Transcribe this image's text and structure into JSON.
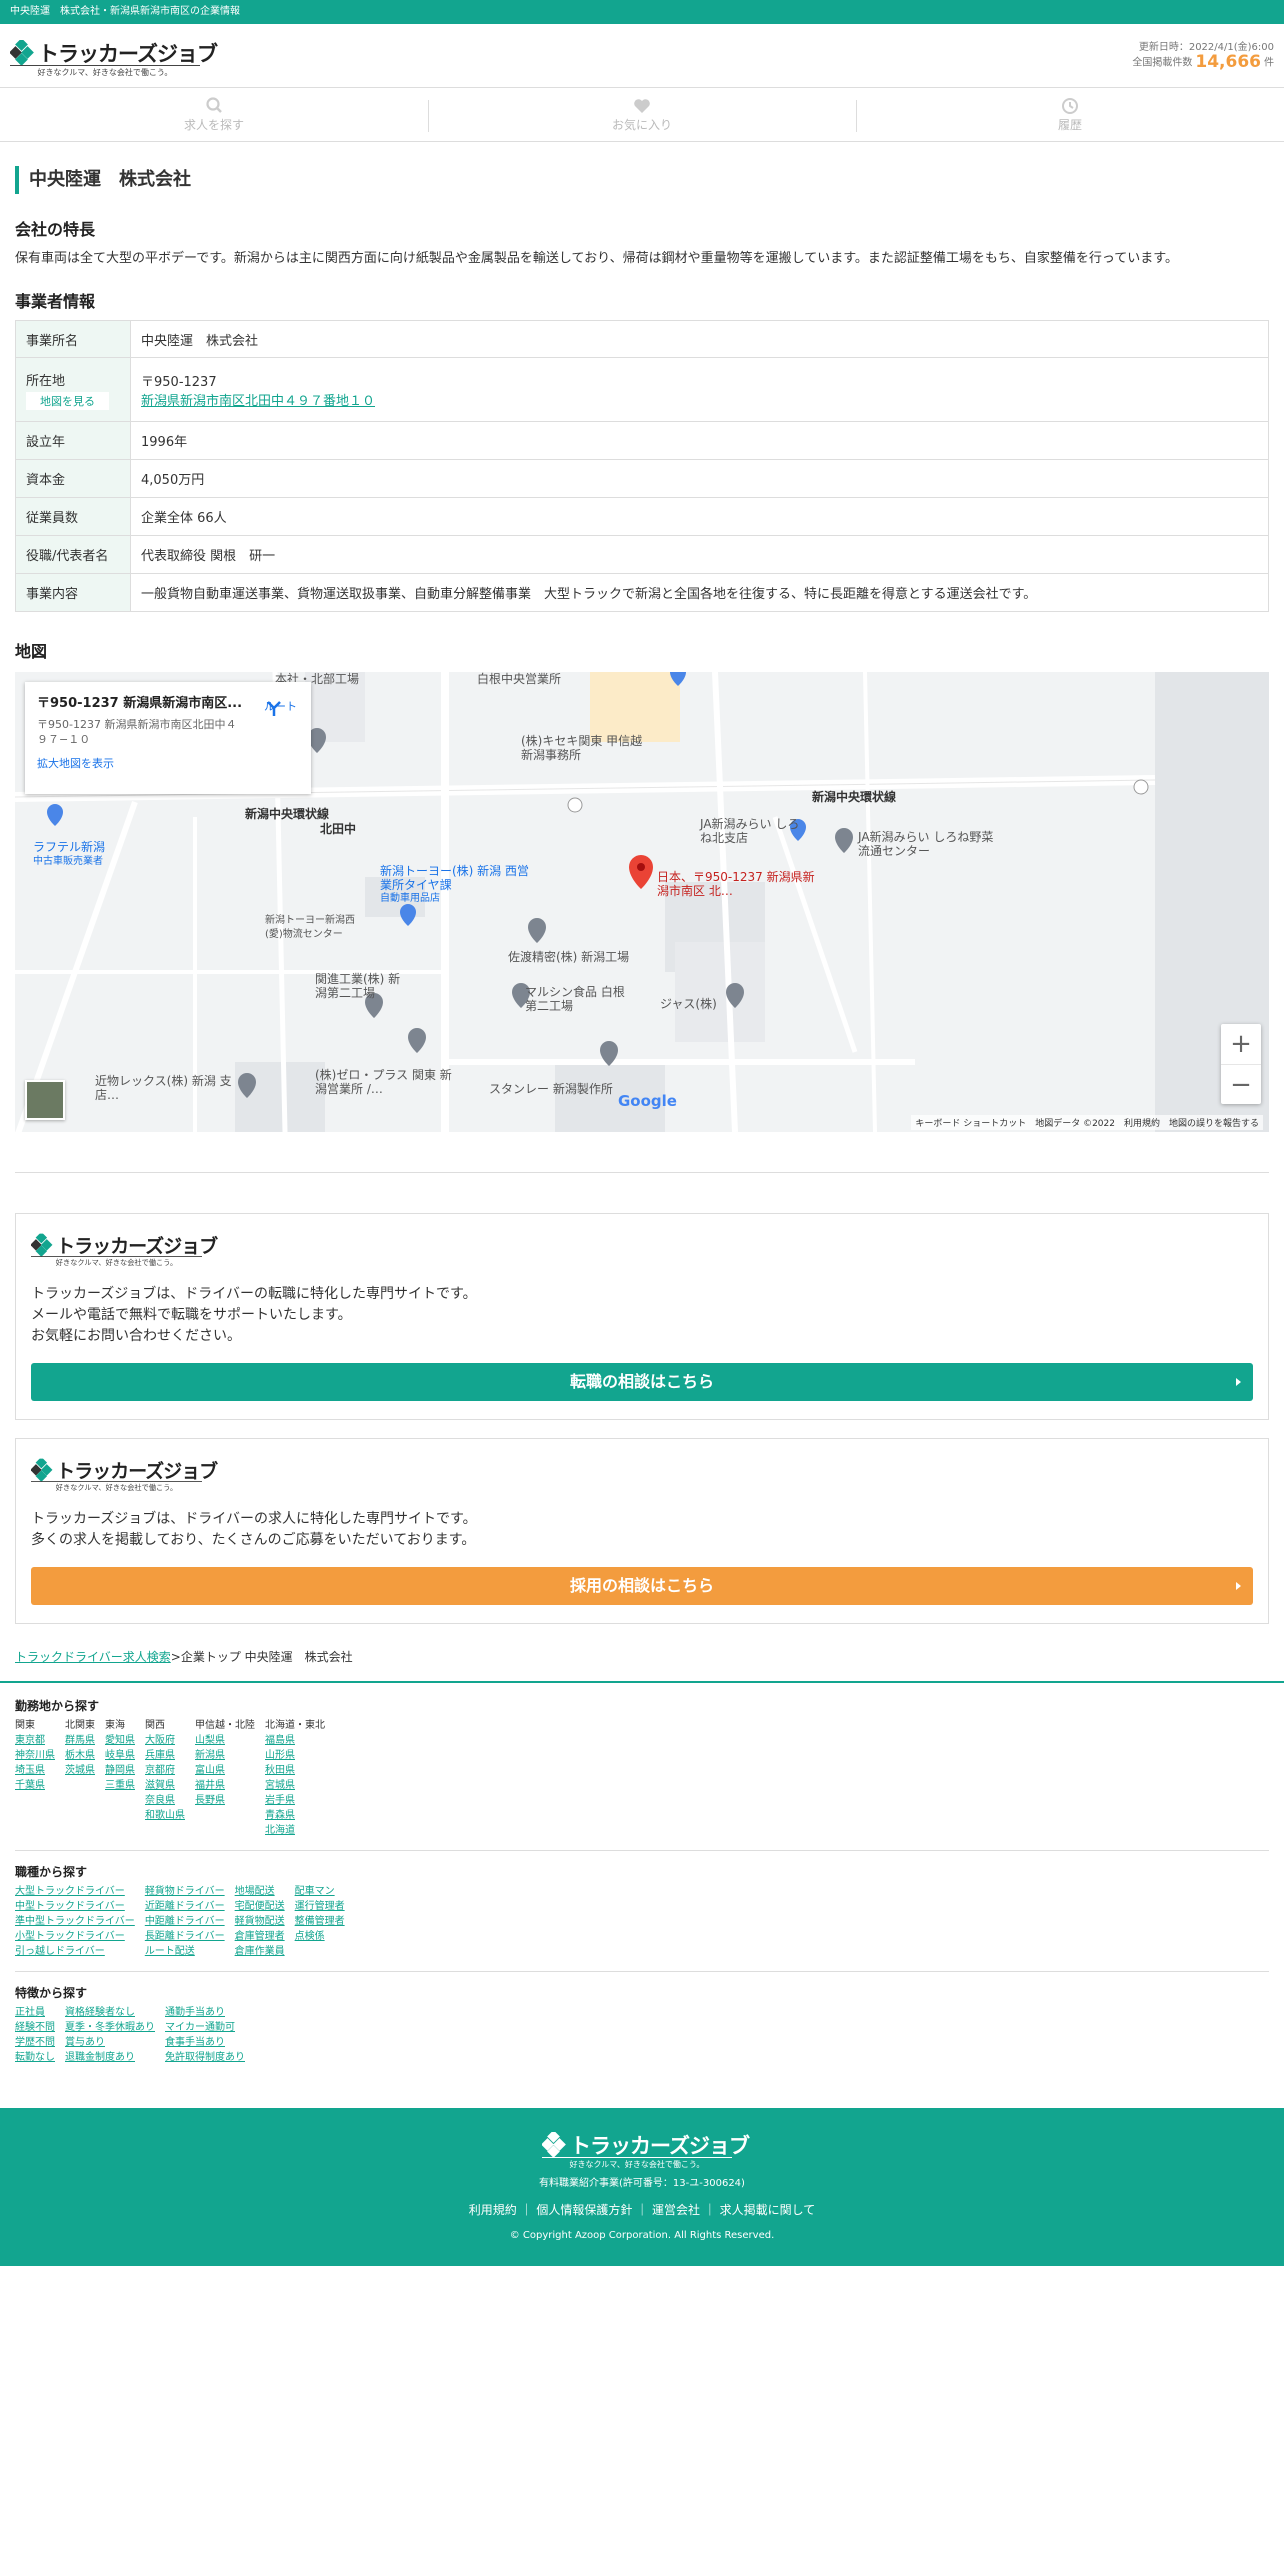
{
  "topbar": "中央陸運　株式会社・新潟県新潟市南区の企業情報",
  "brand": {
    "name": "トラッカーズジョブ",
    "tagline": "好きなクルマ、好きな会社で働こう。"
  },
  "update": {
    "label": "更新日時：2022/4/1(金)6:00",
    "total_label": "全国掲載件数",
    "total": "14,666",
    "unit": "件"
  },
  "gnav": [
    {
      "label": "求人を探す",
      "icon": "search-icon"
    },
    {
      "label": "お気に入り",
      "icon": "heart-icon"
    },
    {
      "label": "履歴",
      "icon": "history-icon"
    }
  ],
  "page_title": "中央陸運　株式会社",
  "features": {
    "heading": "会社の特長",
    "text": "保有車両は全て大型の平ボデーです。新潟からは主に関西方面に向け紙製品や金属製品を輸送しており、帰荷は鋼材や重量物等を運搬しています。また認証整備工場をもち、自家整備を行っています。"
  },
  "business": {
    "heading": "事業者情報",
    "office_label": "事業所名",
    "office": "中央陸運　株式会社",
    "address_label": "所在地",
    "map_button": "地図を見る",
    "zip": "〒950-1237",
    "address": "新潟県新潟市南区北田中４９７番地１０",
    "founded_label": "設立年",
    "founded": "1996年",
    "capital_label": "資本金",
    "capital": "4,050万円",
    "employees_label": "従業員数",
    "employees": "企業全体 66人",
    "rep_label": "役職/代表者名",
    "rep": "代表取締役 関根　研一",
    "content_label": "事業内容",
    "content": "一般貨物自動車運送事業、貨物運送取扱事業、自動車分解整備事業　大型トラックで新潟と全国各地を往復する、特に長距離を得意とする運送会社です。"
  },
  "map": {
    "heading": "地図",
    "card_title": "〒950-1237 新潟県新潟市南区...",
    "card_address": "〒950-1237 新潟県新潟市南区北田中４９７−１０",
    "card_link": "拡大地図を表示",
    "route": "ルート",
    "pin_label": "日本、〒950-1237 新潟県新潟市南区 北…",
    "labels": [
      "本社・北部工場",
      "白根中央営業所",
      "(株)キセキ関東 甲信越 新潟事務所",
      "新潟中央環状線",
      "北田中",
      "新潟中央環状線",
      "JA新潟みらい しろね北支店",
      "JA新潟みらい しろね野菜流通センター",
      "ラフテル新潟",
      "中古車販売業者",
      "新潟トーヨー(株) 新潟 西営業所タイヤ課",
      "自動車用品店",
      "新潟トーヨー新潟西 (愛)物流センター",
      "佐渡精密(株) 新潟工場",
      "マルシン食品 白根第二工場",
      "関進工業(株) 新潟第二工場",
      "ジャス(株)",
      "(株)ゼロ・プラス 関東 新潟営業所 /…",
      "スタンレー 新潟製作所",
      "近物レックス(株) 新潟 支店…"
    ],
    "zoom_in": "+",
    "zoom_out": "−",
    "google": "Google",
    "attribution": "キーボード ショートカット　地図データ ©2022　利用規約　地図の誤りを報告する"
  },
  "promo1": {
    "text1": "トラッカーズジョブは、ドライバーの転職に特化した専門サイトです。",
    "text2": "メールや電話で無料で転職をサポートいたします。",
    "text3": "お気軽にお問い合わせください。",
    "button": "転職の相談はこちら"
  },
  "promo2": {
    "text1": "トラッカーズジョブは、ドライバーの求人に特化した専門サイトです。",
    "text2": "多くの求人を掲載しており、たくさんのご応募をいただいております。",
    "button": "採用の相談はこちら"
  },
  "breadcrumb": {
    "link": "トラックドライバー求人検索",
    "sep": ">",
    "rest": "企業トップ 中央陸運　株式会社"
  },
  "area": {
    "heading": "勤務地から探す",
    "cols": [
      {
        "h": "関東",
        "items": [
          "東京都",
          "神奈川県",
          "埼玉県",
          "千葉県"
        ]
      },
      {
        "h": "北関東",
        "items": [
          "群馬県",
          "栃木県",
          "茨城県"
        ]
      },
      {
        "h": "東海",
        "items": [
          "愛知県",
          "岐阜県",
          "静岡県",
          "三重県"
        ]
      },
      {
        "h": "関西",
        "items": [
          "大阪府",
          "兵庫県",
          "京都府",
          "滋賀県",
          "奈良県",
          "和歌山県"
        ]
      },
      {
        "h": "甲信越・北陸",
        "items": [
          "山梨県",
          "新潟県",
          "富山県",
          "福井県",
          "長野県"
        ]
      },
      {
        "h": "北海道・東北",
        "items": [
          "福島県",
          "山形県",
          "秋田県",
          "宮城県",
          "岩手県",
          "青森県",
          "北海道"
        ]
      }
    ]
  },
  "jobs": {
    "heading": "職種から探す",
    "cols": [
      {
        "items": [
          "大型トラックドライバー",
          "中型トラックドライバー",
          "準中型トラックドライバー",
          "小型トラックドライバー",
          "引っ越しドライバー"
        ]
      },
      {
        "items": [
          "軽貨物ドライバー",
          "近距離ドライバー",
          "中距離ドライバー",
          "長距離ドライバー",
          "ルート配送"
        ]
      },
      {
        "items": [
          "地場配送",
          "宅配便配送",
          "軽貨物配送",
          "倉庫管理者",
          "倉庫作業員"
        ]
      },
      {
        "items": [
          "配車マン",
          "運行管理者",
          "整備管理者",
          "点検係"
        ]
      }
    ]
  },
  "features_search": {
    "heading": "特徴から探す",
    "cols": [
      {
        "items": [
          "正社員",
          "経験不問",
          "学歴不問",
          "転勤なし"
        ]
      },
      {
        "items": [
          "資格経験者なし",
          "夏季・冬季休暇あり",
          "賞与あり",
          "退職金制度あり"
        ]
      },
      {
        "items": [
          "通勤手当あり",
          "マイカー通勤可",
          "食事手当あり",
          "免許取得制度あり"
        ]
      }
    ]
  },
  "footer": {
    "license": "有料職業紹介事業(許可番号：13-ユ-300624)",
    "links": [
      "利用規約",
      "個人情報保護方針",
      "運営会社",
      "求人掲載に関して"
    ],
    "copyright": "© Copyright Azoop Corporation. All Rights Reserved."
  },
  "colors": {
    "brand": "#12a58f",
    "accent": "#f39c3e"
  }
}
